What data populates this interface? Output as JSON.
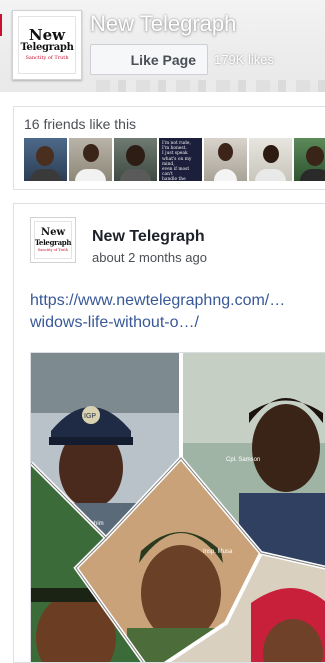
{
  "header": {
    "page_name": "New Telegraph",
    "like_button_label": "Like Page",
    "likes_count": "179K likes"
  },
  "logo": {
    "line1": "New",
    "line2": "Telegraph",
    "tagline": "Sanctity of Truth"
  },
  "friends": {
    "label": "16 friends like this",
    "quote_tile_text": "I'm not rude,\nI'm honest.\nI just speak\nwhat's on my mind,\neven if most can't\nhandle the truth."
  },
  "post": {
    "author": "New Telegraph",
    "time": "about 2 months ago",
    "link_line1": "https://www.newtelegraphng.com/…",
    "link_line2": "widows-life-without-o…/",
    "image_badge": "IGP",
    "image_caption_1": "Insp. Ibrahim",
    "image_caption_2": "Cpl. Samson",
    "image_caption_3": "Insp. Musa"
  },
  "colors": {
    "link": "#385898",
    "brand_red": "#c8102e",
    "border": "#dddfe2"
  }
}
